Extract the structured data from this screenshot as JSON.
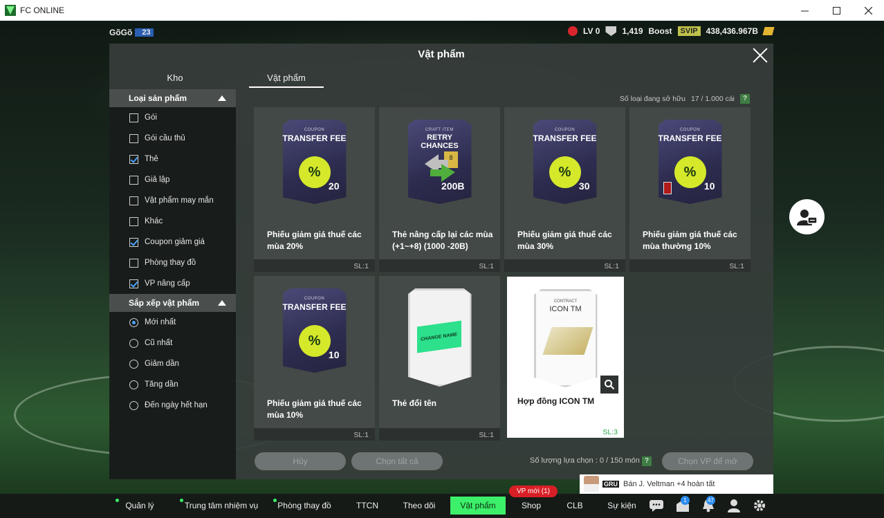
{
  "window": {
    "title": "FC ONLINE",
    "controls": [
      "minimize",
      "maximize",
      "close"
    ]
  },
  "hud": {
    "player_name": "GõGõ",
    "player_level": "23",
    "rank": "LV 0",
    "trophies": "1,419",
    "boost_label": "Boost",
    "svip": "SVIP",
    "bp": "438,436.967B"
  },
  "modal": {
    "title": "Vật phẩm",
    "tabs": [
      {
        "label": "Kho",
        "active": false
      },
      {
        "label": "Vật phẩm",
        "active": true
      }
    ],
    "owned_label": "Số loại đang sở hữu",
    "owned_value": "17 / 1.000 cái",
    "help": "?"
  },
  "sidebar": {
    "filter_header": "Loại sản phẩm",
    "filters": [
      {
        "label": "Gói",
        "checked": false
      },
      {
        "label": "Gói cầu thủ",
        "checked": false
      },
      {
        "label": "Thẻ",
        "checked": true
      },
      {
        "label": "Giả lập",
        "checked": false
      },
      {
        "label": "Vật phẩm may mắn",
        "checked": false
      },
      {
        "label": "Khác",
        "checked": false
      },
      {
        "label": "Coupon giảm giá",
        "checked": true
      },
      {
        "label": "Phòng thay đồ",
        "checked": false
      },
      {
        "label": "VP nâng cấp",
        "checked": true
      }
    ],
    "sort_header": "Sắp xếp vật phẩm",
    "sorts": [
      {
        "label": "Mới nhất",
        "selected": true
      },
      {
        "label": "Cũ nhất",
        "selected": false
      },
      {
        "label": "Giảm dần",
        "selected": false
      },
      {
        "label": "Tăng dần",
        "selected": false
      },
      {
        "label": "Đến ngày hết hạn",
        "selected": false
      }
    ]
  },
  "items": [
    {
      "kind": "coupon",
      "art_small": "COUPON",
      "art_big": "TRANSFER FEE",
      "art_value": "20",
      "name": "Phiếu giảm giá thuế các mùa 20%",
      "qty": "SL:1",
      "selected": false
    },
    {
      "kind": "craft",
      "art_small": "CRAFT ITEM",
      "art_big": "RETRY CHANCES",
      "art_value": "200B",
      "name": "Thẻ nâng cấp lại các mùa (+1~+8) (1000 -20B)",
      "qty": "SL:1",
      "selected": false
    },
    {
      "kind": "coupon",
      "art_small": "COUPON",
      "art_big": "TRANSFER FEE",
      "art_value": "30",
      "name": "Phiếu giảm giá thuế các mùa 30%",
      "qty": "SL:1",
      "selected": false
    },
    {
      "kind": "coupon",
      "art_small": "COUPON",
      "art_big": "TRANSFER FEE",
      "art_value": "10",
      "name": "Phiếu giảm giá thuế các mùa thường 10%",
      "qty": "SL:1",
      "selected": false
    },
    {
      "kind": "coupon",
      "art_small": "COUPON",
      "art_big": "TRANSFER FEE",
      "art_value": "10",
      "name": "Phiếu giảm giá thuế các mùa 10%",
      "qty": "SL:1",
      "selected": false
    },
    {
      "kind": "name",
      "art_small": "",
      "art_big": "CHANGE NAME",
      "art_value": "",
      "name": "Thẻ đổi tên",
      "qty": "SL:1",
      "selected": false
    },
    {
      "kind": "contract",
      "art_small": "CONTRACT",
      "art_big": "ICON TM",
      "art_value": "",
      "name": "Hợp đồng ICON TM",
      "qty": "SL:3",
      "selected": true
    }
  ],
  "footer": {
    "cancel": "Hủy",
    "select_all": "Chọn tất cả",
    "selection_count": "Số lượng lựa chọn : 0 / 150 món",
    "open_selected": "Chọn VP để mở"
  },
  "toast": {
    "club": "GRU",
    "text": "Bán J. Veltman +4 hoàn tất"
  },
  "bottom_nav": {
    "badge": "VP mới (1)",
    "items": [
      {
        "label": "Quản lý CT",
        "dot": true,
        "active": false
      },
      {
        "label": "Trung tâm nhiệm vụ",
        "dot": true,
        "active": false
      },
      {
        "label": "Phòng thay đồ",
        "dot": true,
        "active": false
      },
      {
        "label": "TTCN",
        "dot": false,
        "active": false
      },
      {
        "label": "Theo dõi",
        "dot": false,
        "active": false
      },
      {
        "label": "Vật phẩm",
        "dot": false,
        "active": true
      },
      {
        "label": "Shop",
        "dot": false,
        "active": false
      },
      {
        "label": "CLB",
        "dot": false,
        "active": false
      },
      {
        "label": "Sự kiện",
        "dot": false,
        "active": false
      }
    ],
    "icons": [
      {
        "name": "chat-icon",
        "count": ""
      },
      {
        "name": "inbox-icon",
        "count": "1"
      },
      {
        "name": "bell-icon",
        "count": "47"
      },
      {
        "name": "profile-icon",
        "count": ""
      },
      {
        "name": "settings-icon",
        "count": ""
      }
    ]
  },
  "colors": {
    "accent": "#3df06a",
    "check": "#4aa3ff",
    "badge": "#d81f26",
    "coupon_disc": "#d5e82a"
  }
}
